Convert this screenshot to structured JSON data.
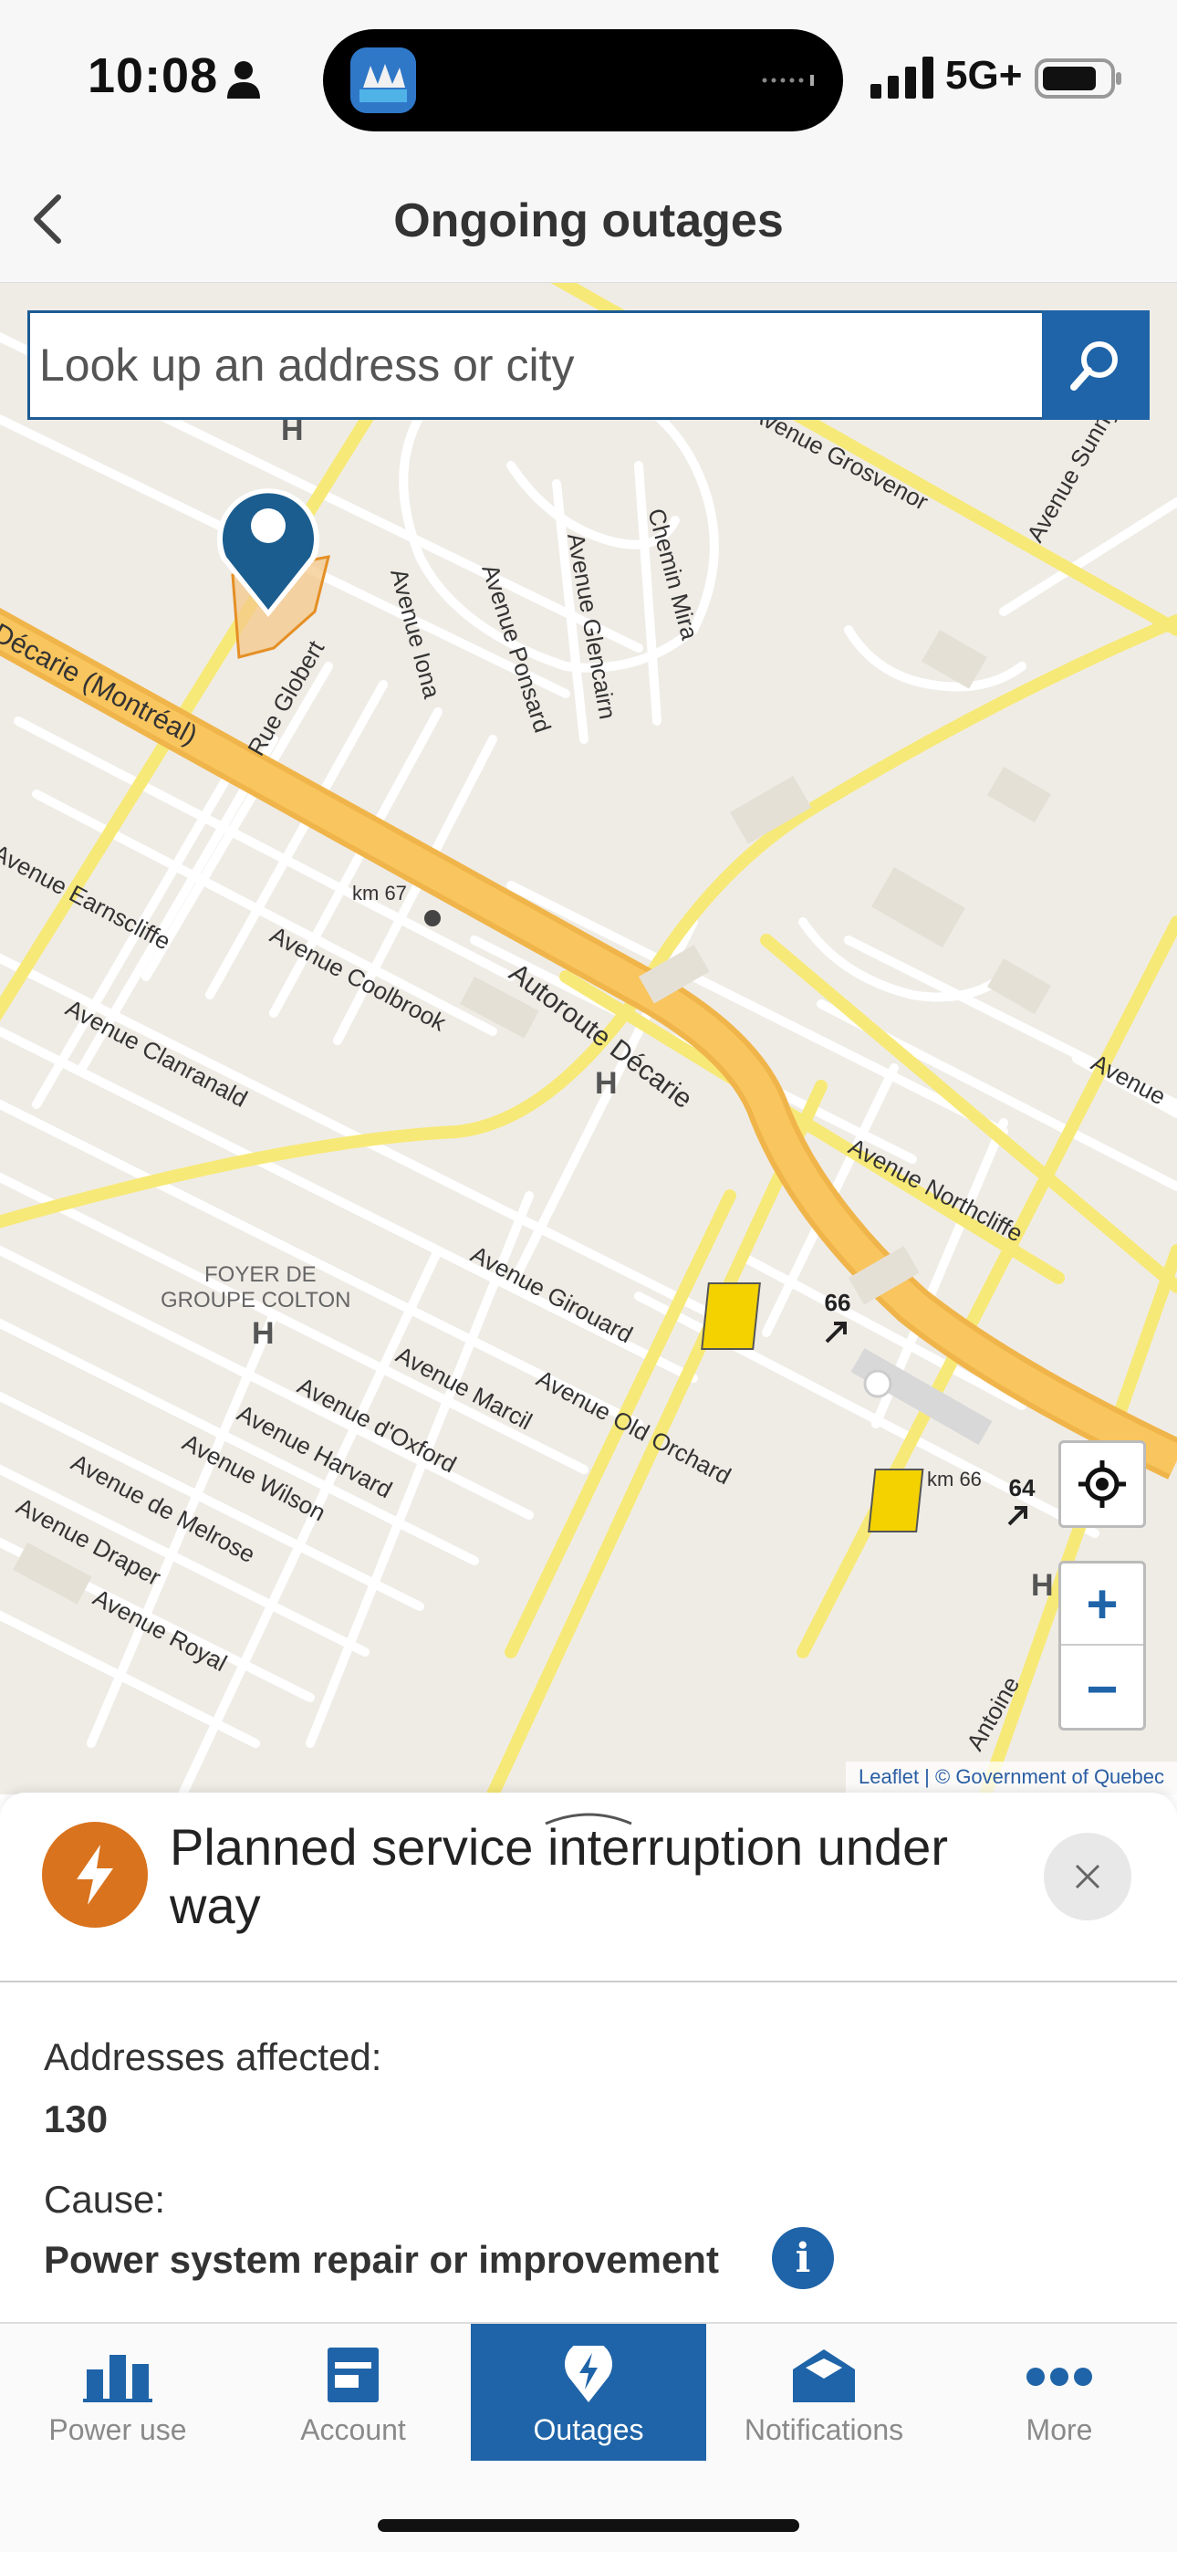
{
  "status_bar": {
    "time": "10:08",
    "network": "5G+"
  },
  "header": {
    "title": "Ongoing outages"
  },
  "search": {
    "placeholder": "Look up an address or city"
  },
  "map": {
    "attribution": "Leaflet | © Government of Quebec",
    "labels": {
      "decarie_montreal": "Décarie (Montréal)",
      "rue_globert": "Rue Globert",
      "avenue_iona": "Avenue Iona",
      "avenue_ponsard": "Avenue Ponsard",
      "avenue_glencairn": "Avenue Glencairn",
      "chemin_mira": "Chemin Mira",
      "avenue_grosvenor": "Avenue Grosvenor",
      "avenue_sunnyside": "Avenue Sunnyside",
      "avenue_earnscliffe": "Avenue Earnscliffe",
      "avenue_coolbrook": "Avenue Coolbrook",
      "avenue_clanranald": "Avenue Clanranald",
      "autoroute_decarie": "Autoroute Décarie",
      "km67": "km 67",
      "km66": "km 66",
      "avenue_northcliffe": "Avenue Northcliffe",
      "foyer1": "FOYER DE",
      "foyer2": "GROUPE COLTON",
      "avenue_girouard": "Avenue Girouard",
      "avenue_marcil": "Avenue Marcil",
      "avenue_old_orchard": "Avenue Old Orchard",
      "avenue_doxford": "Avenue d'Oxford",
      "avenue_harvard": "Avenue Harvard",
      "avenue_wilson": "Avenue Wilson",
      "avenue_de_melrose": "Avenue de Melrose",
      "avenue_draper": "Avenue Draper",
      "avenue_royal": "Avenue Royal",
      "antoine": "Antoine",
      "avenue_top": "Avenue",
      "exit66": "66",
      "exit64": "64",
      "hospital": "H"
    },
    "zoom_in": "+",
    "zoom_out": "−"
  },
  "outage": {
    "title": "Planned service interruption under way",
    "addresses_label": "Addresses affected:",
    "addresses_value": "130",
    "cause_label": "Cause:",
    "cause_value": "Power system repair or improvement",
    "info_glyph": "i",
    "close_glyph": "×"
  },
  "colors": {
    "accent": "#1f64a8",
    "alert": "#d9731d"
  },
  "tabs": [
    {
      "label": "Power use",
      "icon": "bar-chart-icon",
      "active": false
    },
    {
      "label": "Account",
      "icon": "invoice-icon",
      "active": false
    },
    {
      "label": "Outages",
      "icon": "lightning-pin-icon",
      "active": true
    },
    {
      "label": "Notifications",
      "icon": "open-envelope-icon",
      "active": false
    },
    {
      "label": "More",
      "icon": "more-dots-icon",
      "active": false
    }
  ]
}
